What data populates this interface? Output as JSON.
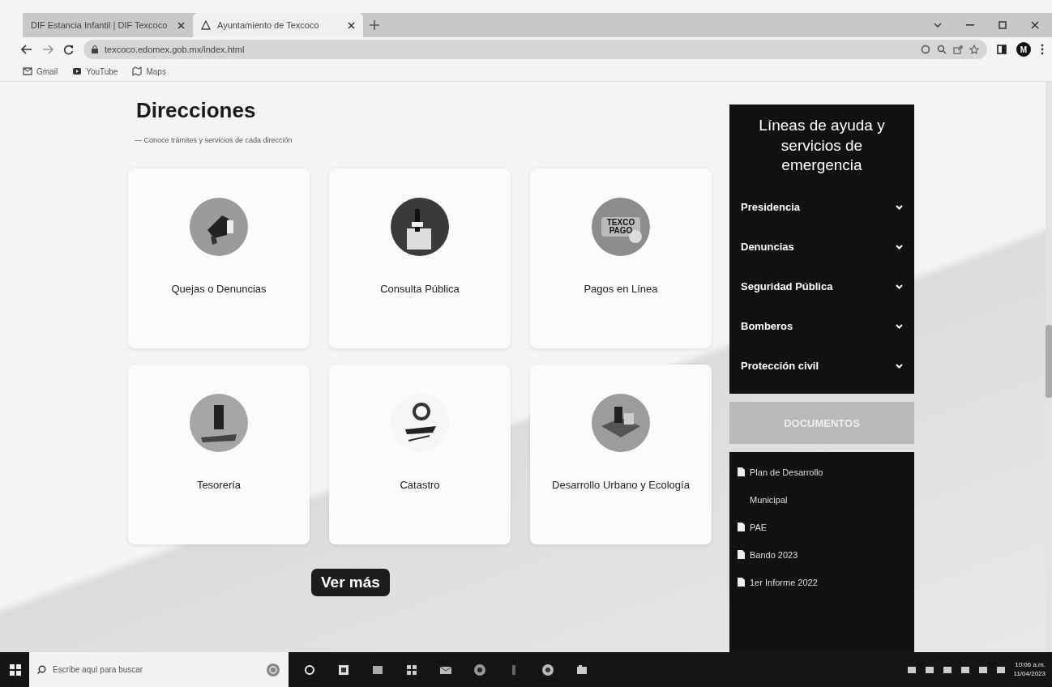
{
  "browser": {
    "tabs": [
      {
        "title": "DIF Estancia Infantil | DIF Texcoco",
        "selected": false
      },
      {
        "title": "Ayuntamiento de Texcoco",
        "selected": true
      }
    ],
    "url": "texcoco.edomex.gob.mx/index.html",
    "bookmarks": [
      "Gmail",
      "YouTube",
      "Maps"
    ],
    "profile_initial": "M"
  },
  "section": {
    "title": "Direcciones",
    "subtitle": "— Conoce trámites y servicios de cada dirección"
  },
  "cards": [
    {
      "label": "Quejas o Denuncias"
    },
    {
      "label": "Consulta Pública"
    },
    {
      "label": "Pagos en Línea",
      "logo_text": "TEXCO PAGO"
    },
    {
      "label": "Tesorería"
    },
    {
      "label": "Catastro"
    },
    {
      "label": "Desarrollo Urbano y Ecología"
    }
  ],
  "more_button": "Ver más",
  "help_panel": {
    "title": "Líneas de ayuda y servicios de emergencia",
    "items": [
      "Presidencia",
      "Denuncias",
      "Seguridad Pública",
      "Bomberos",
      "Protección civil"
    ]
  },
  "documents": {
    "title": "DOCUMENTOS",
    "items": [
      "Plan de Desarrollo Municipal",
      "PAE",
      "Bando 2023",
      "1er Informe 2022"
    ]
  },
  "taskbar": {
    "search_placeholder": "Escribe aquí para buscar",
    "time": "10:06 a.m.",
    "date": "11/04/2023"
  }
}
